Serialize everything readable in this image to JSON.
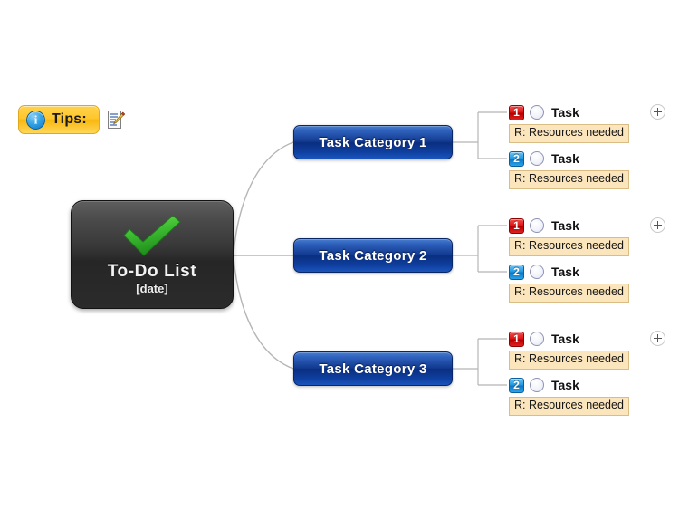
{
  "document": {
    "title": "To-Do List Mind Map",
    "background_color": "#ffffff"
  },
  "tips": {
    "icon": "info-icon",
    "label": "Tips:",
    "note_icon": "note-pencil-icon",
    "badge_color": "#ffc72e",
    "border_color": "#e0a81b"
  },
  "central_node": {
    "icon": "green-check-icon",
    "title": "To-Do List",
    "subtitle": "[date]",
    "fill_color": "#2c2c2c",
    "check_color": "#35b335"
  },
  "categories": [
    {
      "label": "Task Category 1",
      "color": "#0a2e80",
      "expand": "+",
      "tasks": [
        {
          "priority": "1",
          "priority_color": "#b80000",
          "label": "Task",
          "resource": "R: Resources needed"
        },
        {
          "priority": "2",
          "priority_color": "#0f77c4",
          "label": "Task",
          "resource": "R: Resources needed"
        }
      ]
    },
    {
      "label": "Task Category 2",
      "color": "#0a2e80",
      "expand": "+",
      "tasks": [
        {
          "priority": "1",
          "priority_color": "#b80000",
          "label": "Task",
          "resource": "R: Resources needed"
        },
        {
          "priority": "2",
          "priority_color": "#0f77c4",
          "label": "Task",
          "resource": "R: Resources needed"
        }
      ]
    },
    {
      "label": "Task Category 3",
      "color": "#0a2e80",
      "expand": "+",
      "tasks": [
        {
          "priority": "1",
          "priority_color": "#b80000",
          "label": "Task",
          "resource": "R: Resources needed"
        },
        {
          "priority": "2",
          "priority_color": "#0f77c4",
          "label": "Task",
          "resource": "R: Resources needed"
        }
      ]
    }
  ],
  "connectors": {
    "color": "#b0b0b0"
  }
}
